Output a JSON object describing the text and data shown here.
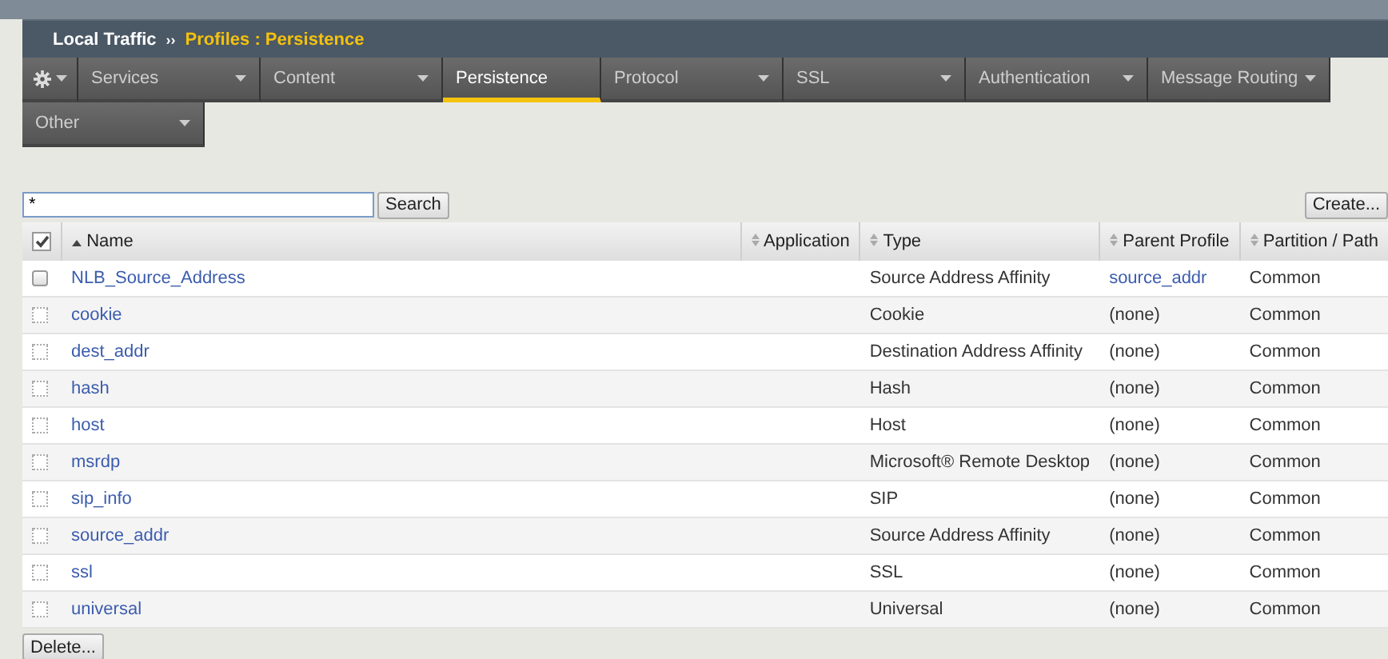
{
  "breadcrumb": {
    "section": "Local Traffic",
    "separator": "››",
    "page": "Profiles : Persistence"
  },
  "tabs": [
    {
      "label": "Services",
      "selected": false
    },
    {
      "label": "Content",
      "selected": false
    },
    {
      "label": "Persistence",
      "selected": true
    },
    {
      "label": "Protocol",
      "selected": false
    },
    {
      "label": "SSL",
      "selected": false
    },
    {
      "label": "Authentication",
      "selected": false
    },
    {
      "label": "Message Routing",
      "selected": false
    },
    {
      "label": "Other",
      "selected": false
    }
  ],
  "search": {
    "value": "*",
    "button": "Search"
  },
  "create_button": "Create...",
  "table": {
    "select_all": {
      "checked": true
    },
    "columns": [
      "Name",
      "Application",
      "Type",
      "Parent Profile",
      "Partition / Path"
    ],
    "rows": [
      {
        "name": "NLB_Source_Address",
        "application": "",
        "type": "Source Address Affinity",
        "parent": "source_addr",
        "parent_link": true,
        "partition": "Common",
        "disabled": false,
        "checked": false
      },
      {
        "name": "cookie",
        "type": "Cookie",
        "parent": "(none)",
        "parent_link": false,
        "partition": "Common",
        "disabled": true,
        "checked": false
      },
      {
        "name": "dest_addr",
        "type": "Destination Address Affinity",
        "parent": "(none)",
        "parent_link": false,
        "partition": "Common",
        "disabled": true,
        "checked": false
      },
      {
        "name": "hash",
        "type": "Hash",
        "parent": "(none)",
        "parent_link": false,
        "partition": "Common",
        "disabled": true,
        "checked": false
      },
      {
        "name": "host",
        "type": "Host",
        "parent": "(none)",
        "parent_link": false,
        "partition": "Common",
        "disabled": true,
        "checked": false
      },
      {
        "name": "msrdp",
        "type": "Microsoft® Remote Desktop",
        "parent": "(none)",
        "parent_link": false,
        "partition": "Common",
        "disabled": true,
        "checked": false
      },
      {
        "name": "sip_info",
        "type": "SIP",
        "parent": "(none)",
        "parent_link": false,
        "partition": "Common",
        "disabled": true,
        "checked": false
      },
      {
        "name": "source_addr",
        "type": "Source Address Affinity",
        "parent": "(none)",
        "parent_link": false,
        "partition": "Common",
        "disabled": true,
        "checked": false
      },
      {
        "name": "ssl",
        "type": "SSL",
        "parent": "(none)",
        "parent_link": false,
        "partition": "Common",
        "disabled": true,
        "checked": false
      },
      {
        "name": "universal",
        "type": "Universal",
        "parent": "(none)",
        "parent_link": false,
        "partition": "Common",
        "disabled": true,
        "checked": false
      }
    ]
  },
  "delete_button": "Delete..."
}
